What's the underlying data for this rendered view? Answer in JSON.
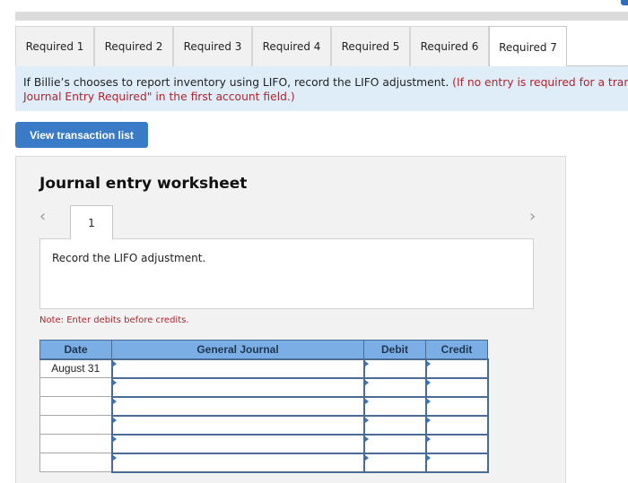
{
  "tabs": [
    {
      "label": "Required 1",
      "active": false
    },
    {
      "label": "Required 2",
      "active": false
    },
    {
      "label": "Required 3",
      "active": false
    },
    {
      "label": "Required 4",
      "active": false
    },
    {
      "label": "Required 5",
      "active": false
    },
    {
      "label": "Required 6",
      "active": false
    },
    {
      "label": "Required 7",
      "active": true
    }
  ],
  "banner": {
    "instruction": "If Billie’s chooses to report inventory using LIFO, record the LIFO adjustment.",
    "hint_line1": "(If no entry is required for a tran",
    "hint_line2": "Journal Entry Required\" in the first account field.)"
  },
  "view_transaction_button": "View transaction list",
  "worksheet": {
    "title": "Journal entry worksheet",
    "current_entry": "1",
    "prev_icon": "‹",
    "next_icon": "›",
    "description": "Record the LIFO adjustment.",
    "note": "Note: Enter debits before credits.",
    "table": {
      "headers": [
        "Date",
        "General Journal",
        "Debit",
        "Credit"
      ],
      "rows": [
        {
          "date": "August 31",
          "account": "",
          "debit": "",
          "credit": ""
        },
        {
          "date": "",
          "account": "",
          "debit": "",
          "credit": ""
        },
        {
          "date": "",
          "account": "",
          "debit": "",
          "credit": ""
        },
        {
          "date": "",
          "account": "",
          "debit": "",
          "credit": ""
        },
        {
          "date": "",
          "account": "",
          "debit": "",
          "credit": ""
        },
        {
          "date": "",
          "account": "",
          "debit": "",
          "credit": ""
        }
      ]
    }
  },
  "colors": {
    "accent_blue": "#3a7bc8",
    "header_blue": "#7aaee4",
    "banner_bg": "#dfedf9",
    "hint_red": "#b0242c"
  }
}
